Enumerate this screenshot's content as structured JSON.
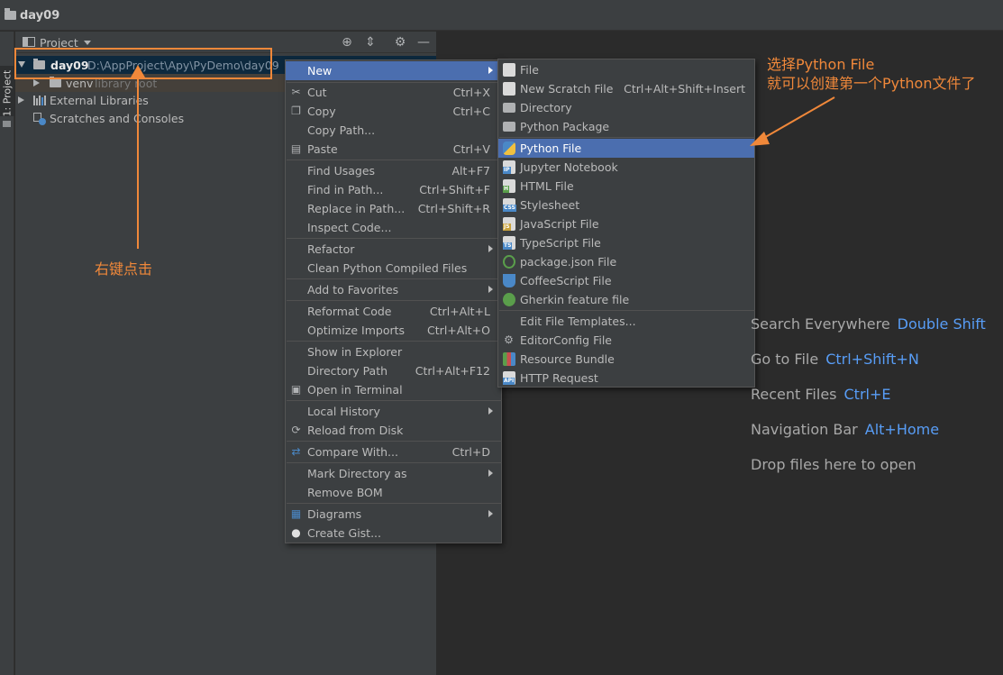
{
  "window": {
    "title": "day09"
  },
  "tool_strip": {
    "tab_label": "1: Project"
  },
  "project_panel": {
    "header_label": "Project",
    "tree": {
      "root_name": "day09",
      "root_path": "D:\\AppProject\\Apy\\PyDemo\\day09",
      "venv_name": "venv",
      "venv_hint": "library root",
      "external_libraries": "External Libraries",
      "scratches": "Scratches and Consoles"
    }
  },
  "context_menu": {
    "items": [
      {
        "label": "New",
        "shortcut": ""
      },
      {
        "label": "Cut",
        "shortcut": "Ctrl+X"
      },
      {
        "label": "Copy",
        "shortcut": "Ctrl+C"
      },
      {
        "label": "Copy Path...",
        "shortcut": ""
      },
      {
        "label": "Paste",
        "shortcut": "Ctrl+V"
      },
      {
        "label": "Find Usages",
        "shortcut": "Alt+F7"
      },
      {
        "label": "Find in Path...",
        "shortcut": "Ctrl+Shift+F"
      },
      {
        "label": "Replace in Path...",
        "shortcut": "Ctrl+Shift+R"
      },
      {
        "label": "Inspect Code...",
        "shortcut": ""
      },
      {
        "label": "Refactor",
        "shortcut": ""
      },
      {
        "label": "Clean Python Compiled Files",
        "shortcut": ""
      },
      {
        "label": "Add to Favorites",
        "shortcut": ""
      },
      {
        "label": "Reformat Code",
        "shortcut": "Ctrl+Alt+L"
      },
      {
        "label": "Optimize Imports",
        "shortcut": "Ctrl+Alt+O"
      },
      {
        "label": "Show in Explorer",
        "shortcut": ""
      },
      {
        "label": "Directory Path",
        "shortcut": "Ctrl+Alt+F12"
      },
      {
        "label": "Open in Terminal",
        "shortcut": ""
      },
      {
        "label": "Local History",
        "shortcut": ""
      },
      {
        "label": "Reload from Disk",
        "shortcut": ""
      },
      {
        "label": "Compare With...",
        "shortcut": "Ctrl+D"
      },
      {
        "label": "Mark Directory as",
        "shortcut": ""
      },
      {
        "label": "Remove BOM",
        "shortcut": ""
      },
      {
        "label": "Diagrams",
        "shortcut": ""
      },
      {
        "label": "Create Gist...",
        "shortcut": ""
      }
    ]
  },
  "new_submenu": {
    "items": [
      {
        "label": "File",
        "shortcut": ""
      },
      {
        "label": "New Scratch File",
        "shortcut": "Ctrl+Alt+Shift+Insert"
      },
      {
        "label": "Directory",
        "shortcut": ""
      },
      {
        "label": "Python Package",
        "shortcut": ""
      },
      {
        "label": "Python File",
        "shortcut": ""
      },
      {
        "label": "Jupyter Notebook",
        "shortcut": ""
      },
      {
        "label": "HTML File",
        "shortcut": ""
      },
      {
        "label": "Stylesheet",
        "shortcut": ""
      },
      {
        "label": "JavaScript File",
        "shortcut": ""
      },
      {
        "label": "TypeScript File",
        "shortcut": ""
      },
      {
        "label": "package.json File",
        "shortcut": ""
      },
      {
        "label": "CoffeeScript File",
        "shortcut": ""
      },
      {
        "label": "Gherkin feature file",
        "shortcut": ""
      },
      {
        "label": "Edit File Templates...",
        "shortcut": ""
      },
      {
        "label": "EditorConfig File",
        "shortcut": ""
      },
      {
        "label": "Resource Bundle",
        "shortcut": ""
      },
      {
        "label": "HTTP Request",
        "shortcut": ""
      }
    ]
  },
  "editor_hints": [
    {
      "label": "Search Everywhere",
      "key": "Double Shift"
    },
    {
      "label": "Go to File",
      "key": "Ctrl+Shift+N"
    },
    {
      "label": "Recent Files",
      "key": "Ctrl+E"
    },
    {
      "label": "Navigation Bar",
      "key": "Alt+Home"
    },
    {
      "label": "Drop files here to open",
      "key": ""
    }
  ],
  "annotations": {
    "right_click": "右键点击",
    "python_file_line1": "选择Python File",
    "python_file_line2": "就可以创建第一个Python文件了"
  },
  "colors": {
    "selection": "#4b6eaf",
    "annotation": "#f0883a",
    "shortcut_key": "#589df6"
  }
}
